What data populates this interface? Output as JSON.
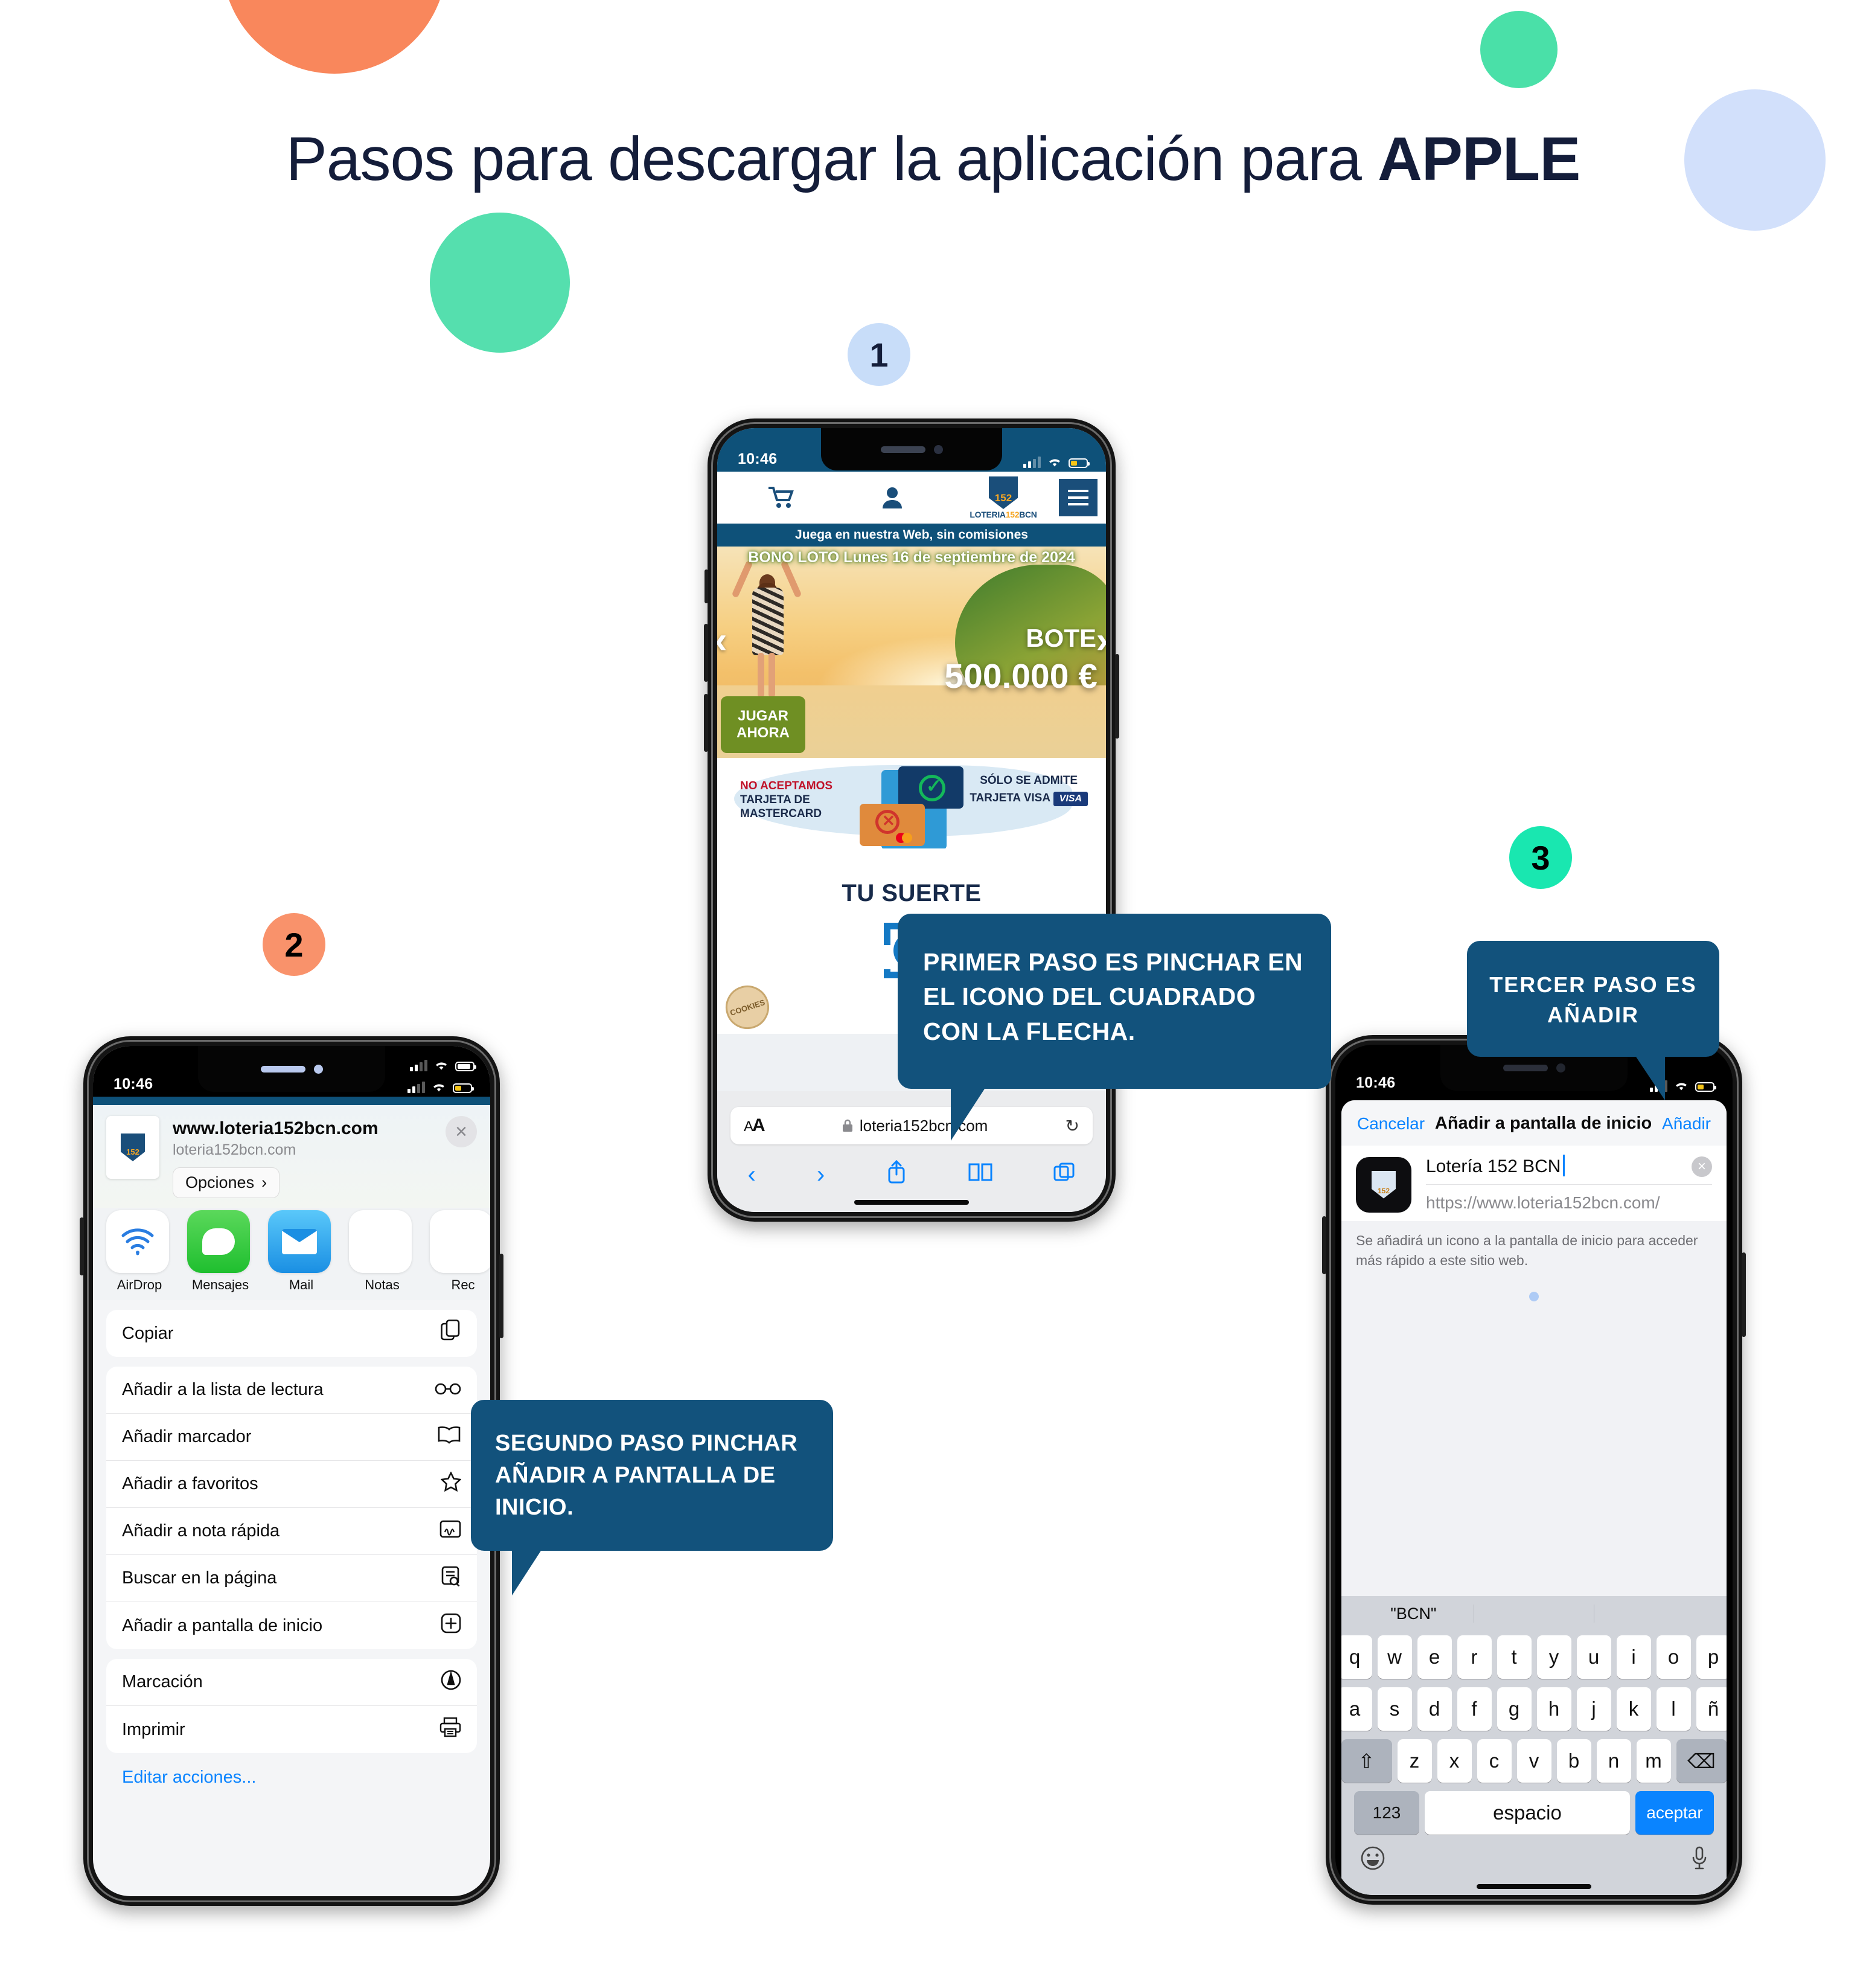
{
  "page": {
    "title_plain": "Pasos para descargar la aplicación para ",
    "title_bold": "APPLE"
  },
  "steps": [
    {
      "badge": "1"
    },
    {
      "badge": "2"
    },
    {
      "badge": "3"
    }
  ],
  "callouts": [
    {
      "id": "callout-1",
      "text": "PRIMER PASO ES PINCHAR  EN EL ICONO DEL CUADRADO CON LA FLECHA."
    },
    {
      "id": "callout-2",
      "text": "SEGUNDO PASO PINCHAR AÑADIR A PANTALLA DE INICIO."
    },
    {
      "id": "callout-3",
      "text": "TERCER PASO  ES AÑADIR"
    }
  ],
  "phone1": {
    "status": {
      "clock": "10:46"
    },
    "navbar": {
      "cart_icon": "shopping-cart-icon",
      "user_icon": "user-icon",
      "logo_number": "152",
      "logo_word_left": "LOTERIA",
      "logo_word_mid": "152",
      "logo_word_right": "BCN",
      "menu_icon": "hamburger-menu-icon"
    },
    "strapline": "Juega en nuestra Web, sin comisiones",
    "hero": {
      "banner_title": "BONO LOTO Lunes 16 de septiembre de 2024",
      "play_button_line1": "JUGAR",
      "play_button_line2": "AHORA",
      "bote_label": "BOTE",
      "amount": "500.000 €",
      "prev_arrow": "‹",
      "next_arrow": "›"
    },
    "cards_banner": {
      "left_title": "NO ACEPTAMOS",
      "left_line2": "TARJETA  DE",
      "left_line3": "MASTERCARD",
      "right_line1": "SÓLO SE ADMITE",
      "right_line2": "TARJETA VISA",
      "visa_chip": "VISA"
    },
    "section_title": "TU SUERTE",
    "cookie_badge": "COOKIES",
    "safari": {
      "text_size_small": "A",
      "text_size_big": "A",
      "lock_icon": "lock-icon",
      "url": "loteria152bcn.com",
      "reload_icon": "↻",
      "back_icon": "‹",
      "forward_icon": "›",
      "share_icon": "share-icon",
      "bookmarks_icon": "book-icon",
      "tabs_icon": "tabs-icon"
    }
  },
  "phone2": {
    "status": {
      "clock": "10:46"
    },
    "share_sheet": {
      "title": "www.loteria152bcn.com",
      "subtitle": "loteria152bcn.com",
      "options_label": "Opciones",
      "options_chevron": "›",
      "close_icon": "×",
      "apps": [
        {
          "name": "AirDrop"
        },
        {
          "name": "Mensajes"
        },
        {
          "name": "Mail"
        },
        {
          "name": "Notas"
        },
        {
          "name": "Rec"
        }
      ]
    },
    "actions_group_1": [
      {
        "label": "Copiar",
        "icon": "copy-icon",
        "glyph": "⧉"
      }
    ],
    "actions_group_2": [
      {
        "label": "Añadir a la lista de lectura",
        "icon": "glasses-icon",
        "glyph": "ᗣᗤ"
      },
      {
        "label": "Añadir marcador",
        "icon": "book-icon",
        "glyph": "▥"
      },
      {
        "label": "Añadir a favoritos",
        "icon": "star-icon",
        "glyph": "☆"
      },
      {
        "label": "Añadir a nota rápida",
        "icon": "quick-note-icon",
        "glyph": "▤"
      },
      {
        "label": "Buscar en la página",
        "icon": "find-in-page-icon",
        "glyph": "▤"
      },
      {
        "label": "Añadir a pantalla de inicio",
        "icon": "add-to-home-icon",
        "glyph": "⊞"
      }
    ],
    "actions_group_3": [
      {
        "label": "Marcación",
        "icon": "markup-icon",
        "glyph": "◬"
      },
      {
        "label": "Imprimir",
        "icon": "printer-icon",
        "glyph": "⎙"
      }
    ],
    "edit_actions": "Editar acciones..."
  },
  "phone3": {
    "status": {
      "clock": "10:46"
    },
    "dialog": {
      "cancel": "Cancelar",
      "title": "Añadir a pantalla de inicio",
      "add": "Añadir",
      "name_value": "Lotería 152 BCN",
      "clear_icon": "×",
      "url": "https://www.loteria152bcn.com/",
      "note": "Se añadirá un icono a la pantalla de inicio para acceder más rápido a este sitio web."
    },
    "keyboard": {
      "prediction": "\"BCN\"",
      "row1": [
        "q",
        "w",
        "e",
        "r",
        "t",
        "y",
        "u",
        "i",
        "o",
        "p"
      ],
      "row2": [
        "a",
        "s",
        "d",
        "f",
        "g",
        "h",
        "j",
        "k",
        "l",
        "ñ"
      ],
      "row3": [
        "z",
        "x",
        "c",
        "v",
        "b",
        "n",
        "m"
      ],
      "shift_icon": "⇧",
      "backspace_icon": "⌫",
      "numbers_key": "123",
      "space_key": "espacio",
      "go_key": "aceptar",
      "emoji_icon": "☺",
      "mic_icon": "mic-icon"
    }
  },
  "colors": {
    "headline": "#141d3a",
    "callout_bg": "#12527c",
    "badge1_bg": "#c8ddf9",
    "badge2_bg": "#f9926b",
    "badge3_bg": "#19e7b0",
    "brand_blue": "#0e5179",
    "ios_blue": "#0a84ff"
  }
}
